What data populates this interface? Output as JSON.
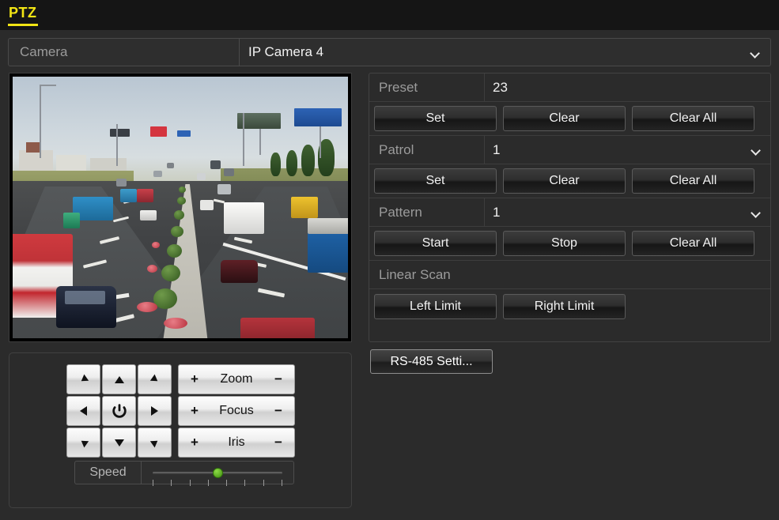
{
  "header": {
    "title": "PTZ"
  },
  "camera": {
    "label": "Camera",
    "value": "IP Camera 4",
    "chevron_icon": "chevron-down-icon"
  },
  "video": {
    "scene": "highway traffic camera live preview"
  },
  "ptz_controls": {
    "directions": [
      {
        "name": "up-left",
        "icon": "arrow-up-left-icon"
      },
      {
        "name": "up",
        "icon": "arrow-up-icon"
      },
      {
        "name": "up-right",
        "icon": "arrow-up-right-icon"
      },
      {
        "name": "left",
        "icon": "arrow-left-icon"
      },
      {
        "name": "auto-scan",
        "icon": "rotate-icon"
      },
      {
        "name": "right",
        "icon": "arrow-right-icon"
      },
      {
        "name": "down-left",
        "icon": "arrow-down-left-icon"
      },
      {
        "name": "down",
        "icon": "arrow-down-icon"
      },
      {
        "name": "down-right",
        "icon": "arrow-down-right-icon"
      }
    ],
    "lens": [
      {
        "name": "zoom",
        "label": "Zoom",
        "plus": "+",
        "minus": "−"
      },
      {
        "name": "focus",
        "label": "Focus",
        "plus": "+",
        "minus": "−"
      },
      {
        "name": "iris",
        "label": "Iris",
        "plus": "+",
        "minus": "−"
      }
    ],
    "speed": {
      "label": "Speed",
      "value": 50,
      "min": 0,
      "max": 100,
      "tick_count": 8
    }
  },
  "right_panel": {
    "preset": {
      "label": "Preset",
      "value": "23",
      "has_chevron": false,
      "buttons": [
        {
          "name": "preset-set",
          "label": "Set"
        },
        {
          "name": "preset-clear",
          "label": "Clear"
        },
        {
          "name": "preset-clear-all",
          "label": "Clear All"
        }
      ]
    },
    "patrol": {
      "label": "Patrol",
      "value": "1",
      "has_chevron": true,
      "chevron_icon": "chevron-down-icon",
      "buttons": [
        {
          "name": "patrol-set",
          "label": "Set"
        },
        {
          "name": "patrol-clear",
          "label": "Clear"
        },
        {
          "name": "patrol-clear-all",
          "label": "Clear All"
        }
      ]
    },
    "pattern": {
      "label": "Pattern",
      "value": "1",
      "has_chevron": true,
      "chevron_icon": "chevron-down-icon",
      "buttons": [
        {
          "name": "pattern-start",
          "label": "Start"
        },
        {
          "name": "pattern-stop",
          "label": "Stop"
        },
        {
          "name": "pattern-clear-all",
          "label": "Clear All"
        }
      ]
    },
    "linear_scan": {
      "label": "Linear Scan",
      "buttons": [
        {
          "name": "left-limit",
          "label": "Left Limit"
        },
        {
          "name": "right-limit",
          "label": "Right Limit"
        }
      ]
    },
    "rs485": {
      "label": "RS-485 Setti..."
    }
  },
  "colors": {
    "page_bg": "#2b2b2b",
    "header_bg": "#151515",
    "accent": "#f2e514",
    "label_text": "#9b9b9b",
    "value_text": "#f0f0f0",
    "slider_knob": "#5aa81c"
  }
}
